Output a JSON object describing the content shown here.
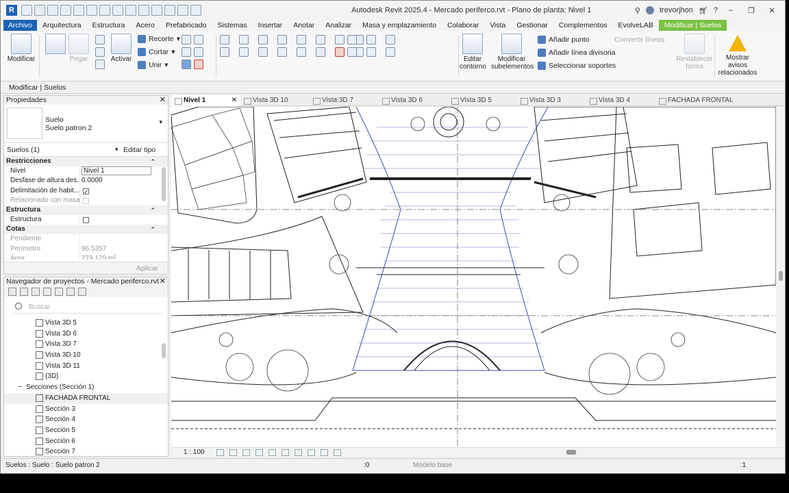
{
  "app": {
    "logo": "R",
    "title": "Autodesk Revit 2025.4 - Mercado periferco.rvt - Plano de planta: Nivel 1",
    "user": "trevorjhon",
    "help": "?"
  },
  "menu": {
    "tabs": [
      "Archivo",
      "Arquitectura",
      "Estructura",
      "Acero",
      "Prefabricado",
      "Sistemas",
      "Insertar",
      "Anotar",
      "Analizar",
      "Masa y emplazamiento",
      "Colaborar",
      "Vista",
      "Gestionar",
      "Complementos",
      "EvolveLAB",
      "Modificar | Suelos"
    ],
    "active": "Modificar | Suelos"
  },
  "ribbon": {
    "modify": "Modificar",
    "paste": "Pegar",
    "activate": "Activar",
    "recorte": "Recorte",
    "cortar": "Cortar",
    "unir": "Unir",
    "editar_contorno": "Editar contorno",
    "modificar_subelementos": "Modificar subelementos",
    "anadir_punto": "Añadir punto",
    "anadir_linea": "Añadir línea divisoria",
    "seleccionar_soportes": "Seleccionar soportes",
    "convertir_lineas": "Convertir líneas",
    "restablecer_forma": "Restablecer forma",
    "mostrar_avisos": "Mostrar avisos relacionados"
  },
  "context_bar": "Modificar | Suelos",
  "properties": {
    "title": "Propiedades",
    "type_name_1": "Suelo",
    "type_name_2": "Suelo patron 2",
    "instance": "Suelos (1)",
    "edit_type": "Editar tipo",
    "sections": {
      "restricciones": "Restricciones",
      "estructura": "Estructura",
      "cotas": "Cotas"
    },
    "rows": {
      "nivel_k": "Nivel",
      "nivel_v": "Nivel 1",
      "desfase_k": "Desfase de altura des...",
      "desfase_v": "0.0000",
      "delim_k": "Delimitación de habit...",
      "relac_k": "Relacionado con masa",
      "estructura_k": "Estructura",
      "pendiente_k": "Pendiente",
      "perimetro_k": "Perímetro",
      "perimetro_v": "96.5357",
      "area_k": "Área",
      "area_v": "279.129 m²"
    },
    "apply": "Aplicar"
  },
  "browser": {
    "title": "Navegador de proyectos - Mercado periferco.rvt",
    "search_placeholder": "Buscar",
    "items": [
      {
        "label": "Vista 3D 5",
        "indent": 1
      },
      {
        "label": "Vista 3D 6",
        "indent": 1
      },
      {
        "label": "Vista 3D 7",
        "indent": 1
      },
      {
        "label": "Vista 3D 10",
        "indent": 1
      },
      {
        "label": "Vista 3D 11",
        "indent": 1
      },
      {
        "label": "{3D}",
        "indent": 1
      },
      {
        "label": "Secciones (Sección 1)",
        "indent": 0
      },
      {
        "label": "FACHADA FRONTAL",
        "indent": 1,
        "selected": true
      },
      {
        "label": "Sección 3",
        "indent": 1
      },
      {
        "label": "Sección 4",
        "indent": 1
      },
      {
        "label": "Sección 5",
        "indent": 1
      },
      {
        "label": "Sección 6",
        "indent": 1
      },
      {
        "label": "Sección 7",
        "indent": 1
      }
    ]
  },
  "view_tabs": [
    {
      "label": "Nivel 1",
      "active": true
    },
    {
      "label": "Vista 3D 10"
    },
    {
      "label": "Vista 3D 7"
    },
    {
      "label": "Vista 3D 6"
    },
    {
      "label": "Vista 3D 5"
    },
    {
      "label": "Vista 3D 3"
    },
    {
      "label": "Vista 3D 4"
    },
    {
      "label": "FACHADA FRONTAL"
    }
  ],
  "view_control": {
    "scale": "1 : 100"
  },
  "status": {
    "selection": "Suelos : Suelo : Suelo patron 2",
    "model": "Modelo base",
    "filter": ":1",
    "workset": ":0"
  },
  "colors": {
    "file_tab": "#1b62b5",
    "active_tab": "#7ac142",
    "floor_lines": "#3b4fa8"
  }
}
